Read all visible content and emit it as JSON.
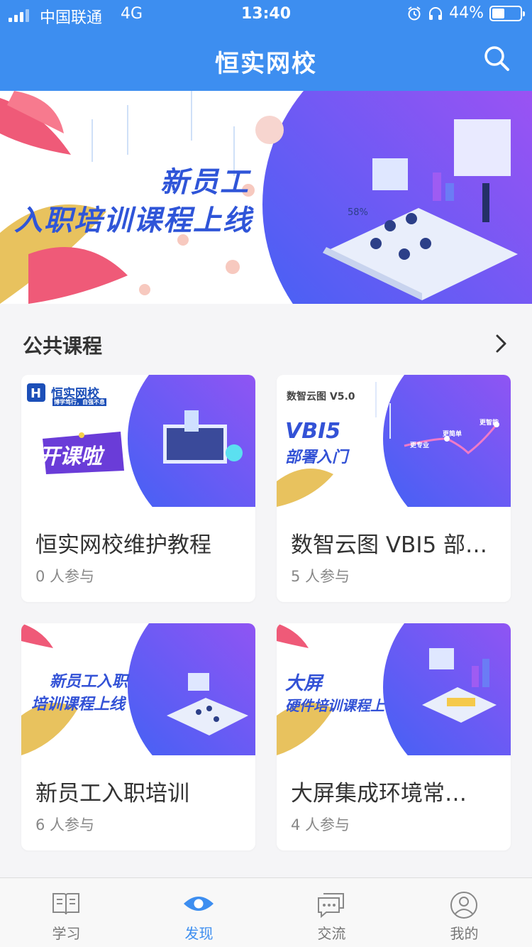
{
  "status_bar": {
    "carrier": "中国联通",
    "network": "4G",
    "time": "13:40",
    "battery": "44%",
    "battery_level": 0.44
  },
  "header": {
    "title": "恒实网校",
    "search_icon": "search-icon"
  },
  "banner": {
    "line1": "新员工",
    "line2": "入职培训课程上线"
  },
  "section": {
    "title": "公共课程",
    "more_icon": "chevron-right-icon"
  },
  "courses": [
    {
      "name": "恒实网校维护教程",
      "participants": "0 人参与",
      "thumb_brand": "恒实网校",
      "thumb_tagline": "博学笃行，自强不息",
      "thumb_text": "开课啦"
    },
    {
      "name": "数智云图 VBI5 部…",
      "participants": "5 人参与",
      "thumb_brand": "数智云图 V5.0",
      "thumb_text_1": "VBI5",
      "thumb_text_2": "部署入门",
      "thumb_points": [
        "更专业",
        "更简单",
        "更智能"
      ]
    },
    {
      "name": "新员工入职培训",
      "participants": "6 人参与",
      "thumb_text_1": "新员工入职",
      "thumb_text_2": "培训课程上线"
    },
    {
      "name": "大屏集成环境常…",
      "participants": "4 人参与",
      "thumb_text_1": "大屏",
      "thumb_text_2": "硬件培训课程上"
    }
  ],
  "tabbar": {
    "items": [
      {
        "label": "学习",
        "icon": "book-icon"
      },
      {
        "label": "发现",
        "icon": "eye-icon",
        "active": true
      },
      {
        "label": "交流",
        "icon": "chat-icon"
      },
      {
        "label": "我的",
        "icon": "user-icon"
      }
    ]
  },
  "colors": {
    "primary": "#3d8ef0",
    "banner_text": "#2f55d8",
    "gradient_start": "#3a63f5",
    "gradient_end": "#b44ef2"
  }
}
